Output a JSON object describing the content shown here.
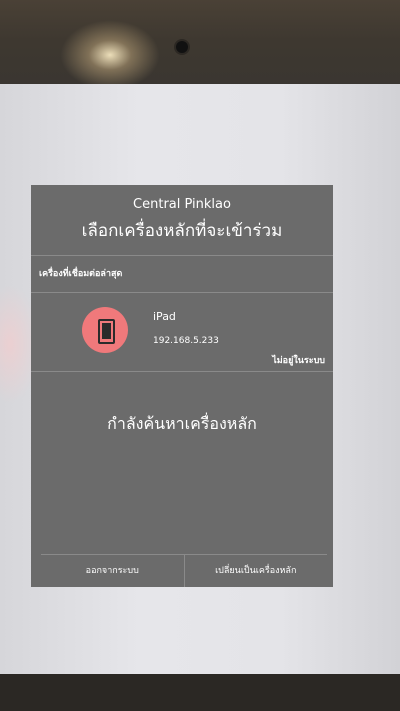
{
  "dialog": {
    "subtitle": "Central Pinklao",
    "title": "เลือกเครื่องหลักที่จะเข้าร่วม",
    "section_label": "เครื่องที่เชื่อมต่อล่าสุด",
    "device": {
      "icon": "tablet-icon",
      "name": "iPad",
      "ip": "192.168.5.233",
      "status": "ไม่อยู่ในระบบ"
    },
    "searching_text": "กำลังค้นหาเครื่องหลัก",
    "logout_label": "ออกจากระบบ",
    "switch_label": "เปลี่ยนเป็นเครื่องหลัก"
  },
  "colors": {
    "dialog_bg": "#6b6b6b",
    "device_icon_bg": "#f0797b"
  }
}
